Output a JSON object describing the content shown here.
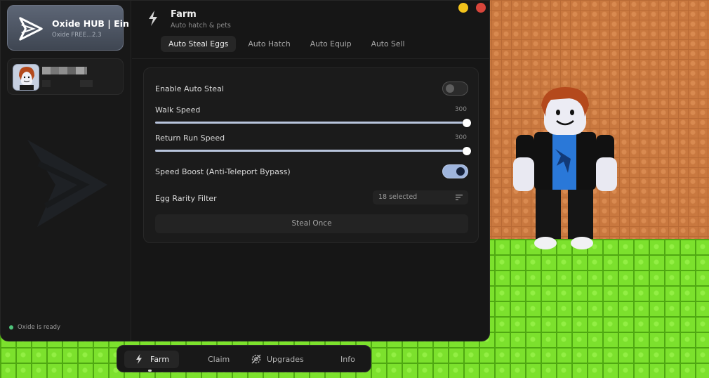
{
  "app": {
    "brand_title": "Oxide HUB | Ein",
    "brand_subtitle": "Oxide FREE...2.3",
    "status_text": "Oxide is ready"
  },
  "header": {
    "title": "Farm",
    "subtitle": "Auto hatch & pets"
  },
  "tabs": [
    {
      "label": "Auto Steal Eggs",
      "active": true
    },
    {
      "label": "Auto Hatch",
      "active": false
    },
    {
      "label": "Auto Equip",
      "active": false
    },
    {
      "label": "Auto Sell",
      "active": false
    }
  ],
  "settings": {
    "enable_auto_steal": {
      "label": "Enable Auto Steal",
      "value": false
    },
    "walk_speed": {
      "label": "Walk Speed",
      "value": "300",
      "fill": 1.0
    },
    "return_run_speed": {
      "label": "Return Run Speed",
      "value": "300",
      "fill": 1.0
    },
    "speed_boost": {
      "label": "Speed Boost (Anti-Teleport Bypass)",
      "value": true
    },
    "egg_rarity_filter": {
      "label": "Egg Rarity Filter",
      "selected_text": "18 selected"
    },
    "steal_once_label": "Steal Once"
  },
  "bottom_nav": [
    {
      "label": "Farm",
      "icon": "bolt-icon",
      "active": true
    },
    {
      "label": "Claim",
      "icon": "",
      "active": false
    },
    {
      "label": "Upgrades",
      "icon": "gear-icon",
      "active": false
    },
    {
      "label": "Info",
      "icon": "",
      "active": false
    }
  ],
  "colors": {
    "accent": "#9fb5dd",
    "status_dot": "#4ec37a",
    "minimize": "#f2c21b",
    "close": "#d8453b"
  }
}
